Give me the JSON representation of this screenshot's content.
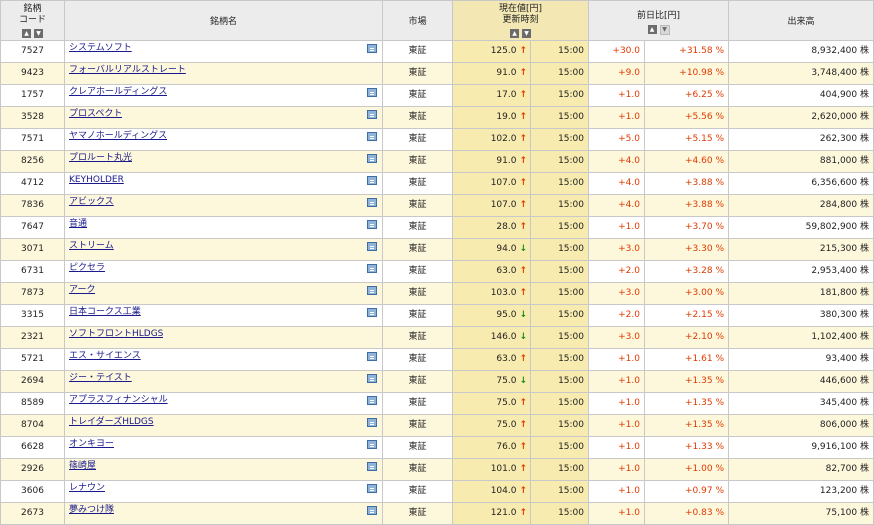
{
  "header": {
    "code": "銘柄\nコード",
    "name": "銘柄名",
    "market": "市場",
    "price": "現在値[円]\n更新時刻",
    "change": "前日比[円]",
    "volume": "出来高"
  },
  "rows": [
    {
      "code": "7527",
      "name": "システムソフト",
      "memo": true,
      "market": "東証",
      "price": "125.0",
      "dir": "up",
      "time": "15:00",
      "chg": "+30.0",
      "pct": "+31.58 %",
      "vol": "8,932,400 株"
    },
    {
      "code": "9423",
      "name": "フォーバルリアルストレート",
      "memo": false,
      "market": "東証",
      "price": "91.0",
      "dir": "up",
      "time": "15:00",
      "chg": "+9.0",
      "pct": "+10.98 %",
      "vol": "3,748,400 株"
    },
    {
      "code": "1757",
      "name": "クレアホールディングス",
      "memo": true,
      "market": "東証",
      "price": "17.0",
      "dir": "up",
      "time": "15:00",
      "chg": "+1.0",
      "pct": "+6.25 %",
      "vol": "404,900 株"
    },
    {
      "code": "3528",
      "name": "プロスペクト",
      "memo": true,
      "market": "東証",
      "price": "19.0",
      "dir": "up",
      "time": "15:00",
      "chg": "+1.0",
      "pct": "+5.56 %",
      "vol": "2,620,000 株"
    },
    {
      "code": "7571",
      "name": "ヤマノホールディングス",
      "memo": true,
      "market": "東証",
      "price": "102.0",
      "dir": "up",
      "time": "15:00",
      "chg": "+5.0",
      "pct": "+5.15 %",
      "vol": "262,300 株"
    },
    {
      "code": "8256",
      "name": "プロルート丸光",
      "memo": true,
      "market": "東証",
      "price": "91.0",
      "dir": "up",
      "time": "15:00",
      "chg": "+4.0",
      "pct": "+4.60 %",
      "vol": "881,000 株"
    },
    {
      "code": "4712",
      "name": "KEYHOLDER",
      "memo": true,
      "market": "東証",
      "price": "107.0",
      "dir": "up",
      "time": "15:00",
      "chg": "+4.0",
      "pct": "+3.88 %",
      "vol": "6,356,600 株"
    },
    {
      "code": "7836",
      "name": "アビックス",
      "memo": true,
      "market": "東証",
      "price": "107.0",
      "dir": "up",
      "time": "15:00",
      "chg": "+4.0",
      "pct": "+3.88 %",
      "vol": "284,800 株"
    },
    {
      "code": "7647",
      "name": "音通",
      "memo": true,
      "market": "東証",
      "price": "28.0",
      "dir": "up",
      "time": "15:00",
      "chg": "+1.0",
      "pct": "+3.70 %",
      "vol": "59,802,900 株"
    },
    {
      "code": "3071",
      "name": "ストリーム",
      "memo": true,
      "market": "東証",
      "price": "94.0",
      "dir": "down",
      "time": "15:00",
      "chg": "+3.0",
      "pct": "+3.30 %",
      "vol": "215,300 株"
    },
    {
      "code": "6731",
      "name": "ピクセラ",
      "memo": true,
      "market": "東証",
      "price": "63.0",
      "dir": "up",
      "time": "15:00",
      "chg": "+2.0",
      "pct": "+3.28 %",
      "vol": "2,953,400 株"
    },
    {
      "code": "7873",
      "name": "アーク",
      "memo": true,
      "market": "東証",
      "price": "103.0",
      "dir": "up",
      "time": "15:00",
      "chg": "+3.0",
      "pct": "+3.00 %",
      "vol": "181,800 株"
    },
    {
      "code": "3315",
      "name": "日本コークス工業",
      "memo": true,
      "market": "東証",
      "price": "95.0",
      "dir": "down",
      "time": "15:00",
      "chg": "+2.0",
      "pct": "+2.15 %",
      "vol": "380,300 株"
    },
    {
      "code": "2321",
      "name": "ソフトフロントHLDGS",
      "memo": false,
      "market": "東証",
      "price": "146.0",
      "dir": "down",
      "time": "15:00",
      "chg": "+3.0",
      "pct": "+2.10 %",
      "vol": "1,102,400 株"
    },
    {
      "code": "5721",
      "name": "エス・サイエンス",
      "memo": true,
      "market": "東証",
      "price": "63.0",
      "dir": "up",
      "time": "15:00",
      "chg": "+1.0",
      "pct": "+1.61 %",
      "vol": "93,400 株"
    },
    {
      "code": "2694",
      "name": "ジー・テイスト",
      "memo": true,
      "market": "東証",
      "price": "75.0",
      "dir": "down",
      "time": "15:00",
      "chg": "+1.0",
      "pct": "+1.35 %",
      "vol": "446,600 株"
    },
    {
      "code": "8589",
      "name": "アプラスフィナンシャル",
      "memo": true,
      "market": "東証",
      "price": "75.0",
      "dir": "up",
      "time": "15:00",
      "chg": "+1.0",
      "pct": "+1.35 %",
      "vol": "345,400 株"
    },
    {
      "code": "8704",
      "name": "トレイダーズHLDGS",
      "memo": true,
      "market": "東証",
      "price": "75.0",
      "dir": "up",
      "time": "15:00",
      "chg": "+1.0",
      "pct": "+1.35 %",
      "vol": "806,000 株"
    },
    {
      "code": "6628",
      "name": "オンキヨー",
      "memo": true,
      "market": "東証",
      "price": "76.0",
      "dir": "up",
      "time": "15:00",
      "chg": "+1.0",
      "pct": "+1.33 %",
      "vol": "9,916,100 株"
    },
    {
      "code": "2926",
      "name": "篠崎屋",
      "memo": true,
      "market": "東証",
      "price": "101.0",
      "dir": "up",
      "time": "15:00",
      "chg": "+1.0",
      "pct": "+1.00 %",
      "vol": "82,700 株"
    },
    {
      "code": "3606",
      "name": "レナウン",
      "memo": true,
      "market": "東証",
      "price": "104.0",
      "dir": "up",
      "time": "15:00",
      "chg": "+1.0",
      "pct": "+0.97 %",
      "vol": "123,200 株"
    },
    {
      "code": "2673",
      "name": "夢みつけ隊",
      "memo": true,
      "market": "東証",
      "price": "121.0",
      "dir": "up",
      "time": "15:00",
      "chg": "+1.0",
      "pct": "+0.83 %",
      "vol": "75,100 株"
    }
  ]
}
